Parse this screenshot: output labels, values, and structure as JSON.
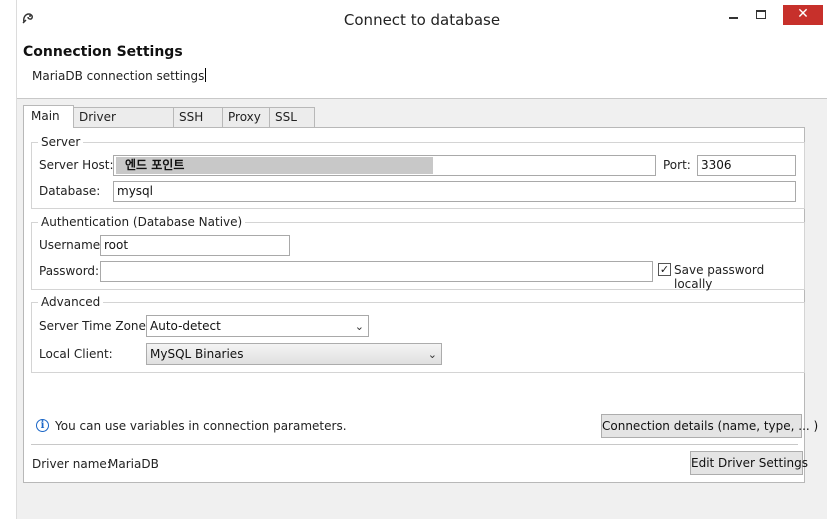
{
  "window": {
    "title": "Connect to database",
    "close_glyph": "✕",
    "icon": "dbeaver-app-icon"
  },
  "header": {
    "title": "Connection Settings",
    "subtitle": "MariaDB connection settings"
  },
  "tabs": [
    {
      "label": "Main",
      "active": true
    },
    {
      "label": "Driver properties",
      "active": false
    },
    {
      "label": "SSH",
      "active": false
    },
    {
      "label": "Proxy",
      "active": false
    },
    {
      "label": "SSL",
      "active": false
    }
  ],
  "server": {
    "legend": "Server",
    "host_label": "Server Host:",
    "host_value": "엔드 포인트",
    "port_label": "Port:",
    "port_value": "3306",
    "database_label": "Database:",
    "database_value": "mysql"
  },
  "auth": {
    "legend": "Authentication (Database Native)",
    "username_label": "Username:",
    "username_value": "root",
    "password_label": "Password:",
    "password_value": "",
    "save_password_label": "Save password locally",
    "save_password_checked": true
  },
  "advanced": {
    "legend": "Advanced",
    "timezone_label": "Server Time Zone:",
    "timezone_value": "Auto-detect",
    "local_client_label": "Local Client:",
    "local_client_value": "MySQL Binaries"
  },
  "footer": {
    "info_text": "You can use variables in connection parameters.",
    "connection_details_button": "Connection details (name, type, ... )",
    "driver_name_label": "Driver name:",
    "driver_name_value": "MariaDB",
    "edit_driver_button": "Edit Driver Settings"
  },
  "colors": {
    "close_button": "#c7302b",
    "info_icon": "#1a66c7",
    "host_highlight": "#c8c8c8"
  }
}
